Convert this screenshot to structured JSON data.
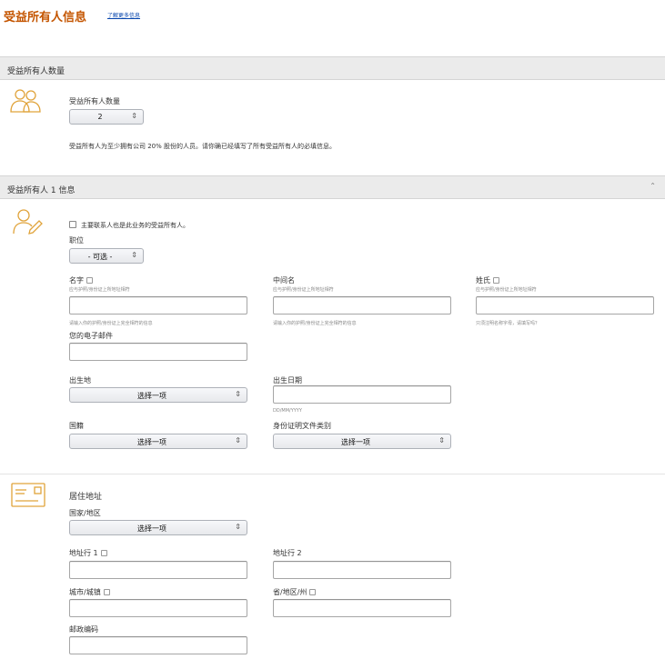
{
  "header": {
    "title": "受益所有人信息",
    "learn_more": "了解更多信息"
  },
  "count_section": {
    "bar_title": "受益所有人数量",
    "label": "受益所有人数量",
    "select_value": "2",
    "description": "受益所有人为至少拥有公司 20% 股份的人员。请你确已经填写了所有受益所有人的必填信息。"
  },
  "owner_section": {
    "bar_title": "受益所有人 1 信息",
    "checkbox_label": "主要联系人也是此业务的受益所有人。",
    "position_label": "职位",
    "position_value": "- 可选 -",
    "first_name_label": "名字",
    "first_name_hint": "应与护照/身份证上所地址相符",
    "first_name_note": "请输入你的护照/身份证上完全相符的信息",
    "middle_name_label": "中间名",
    "middle_name_hint": "应与护照/身份证上所地址相符",
    "middle_name_note": "请输入你的护照/身份证上完全相符的信息",
    "last_name_label": "姓氏",
    "last_name_hint": "应与护照/身份证上所地址相符",
    "last_name_note": "只须注明名称字母，请填写吗？",
    "email_label": "您的电子邮件",
    "birthplace_label": "出生地",
    "birthplace_value": "选择一项",
    "birthdate_label": "出生日期",
    "birthdate_hint": "DD/MM/YYYY",
    "nationality_label": "国籍",
    "nationality_value": "选择一项",
    "id_type_label": "身份证明文件类别",
    "id_type_value": "选择一项"
  },
  "address_section": {
    "title": "居住地址",
    "country_label": "国家/地区",
    "country_value": "选择一项",
    "line1_label": "地址行 1",
    "line2_label": "地址行 2",
    "city_label": "城市/城镇",
    "state_label": "省/地区/州",
    "zip_label": "邮政编码"
  },
  "icons": {
    "people": "people-icon",
    "person_edit": "person-edit-icon",
    "address_card": "address-card-icon",
    "chevron": "chevron-up-icon"
  },
  "colors": {
    "title_orange": "#c45500",
    "icon_orange": "#e0a33a",
    "link_blue": "#0645ad"
  }
}
